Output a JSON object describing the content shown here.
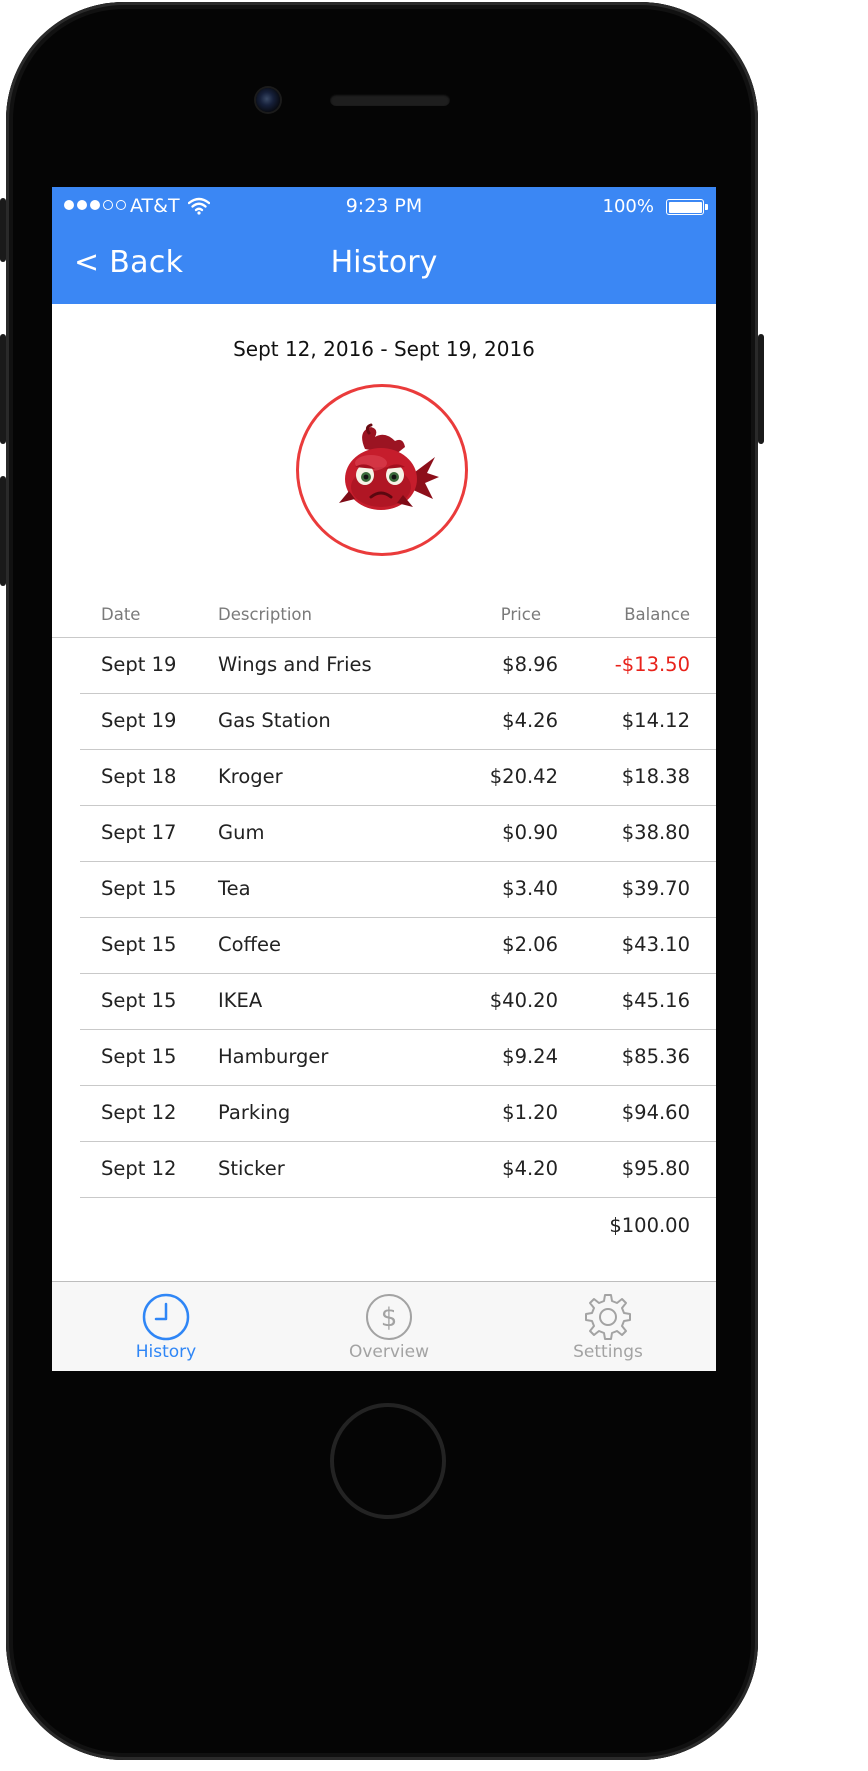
{
  "status_bar": {
    "carrier": "AT&T",
    "time": "9:23 PM",
    "battery": "100%",
    "signal_bars_filled": 3,
    "signal_bars_total": 5
  },
  "nav": {
    "back_label": "< Back",
    "title": "History"
  },
  "period": "Sept 12, 2016 - Sept 19, 2016",
  "avatar": {
    "icon": "sad-red-fish-icon"
  },
  "table": {
    "headers": {
      "date": "Date",
      "description": "Description",
      "price": "Price",
      "balance": "Balance"
    },
    "rows": [
      {
        "date": "Sept 19",
        "description": "Wings and Fries",
        "price": "$8.96",
        "balance": "-$13.50",
        "negative": true
      },
      {
        "date": "Sept 19",
        "description": "Gas Station",
        "price": "$4.26",
        "balance": "$14.12"
      },
      {
        "date": "Sept 18",
        "description": "Kroger",
        "price": "$20.42",
        "balance": "$18.38"
      },
      {
        "date": "Sept 17",
        "description": "Gum",
        "price": "$0.90",
        "balance": "$38.80"
      },
      {
        "date": "Sept 15",
        "description": "Tea",
        "price": "$3.40",
        "balance": "$39.70"
      },
      {
        "date": "Sept 15",
        "description": "Coffee",
        "price": "$2.06",
        "balance": "$43.10"
      },
      {
        "date": "Sept 15",
        "description": "IKEA",
        "price": "$40.20",
        "balance": "$45.16"
      },
      {
        "date": "Sept 15",
        "description": "Hamburger",
        "price": "$9.24",
        "balance": "$85.36"
      },
      {
        "date": "Sept 12",
        "description": "Parking",
        "price": "$1.20",
        "balance": "$94.60"
      },
      {
        "date": "Sept 12",
        "description": "Sticker",
        "price": "$4.20",
        "balance": "$95.80"
      }
    ],
    "starting_balance": "$100.00"
  },
  "tabs": [
    {
      "label": "History",
      "icon": "clock-icon",
      "active": true
    },
    {
      "label": "Overview",
      "icon": "dollar-icon",
      "active": false
    },
    {
      "label": "Settings",
      "icon": "gear-icon",
      "active": false
    }
  ],
  "colors": {
    "nav_bar": "#3b87f4",
    "accent": "#2f86f6",
    "negative": "#e8221a",
    "avatar_ring": "#ea3b3b"
  }
}
